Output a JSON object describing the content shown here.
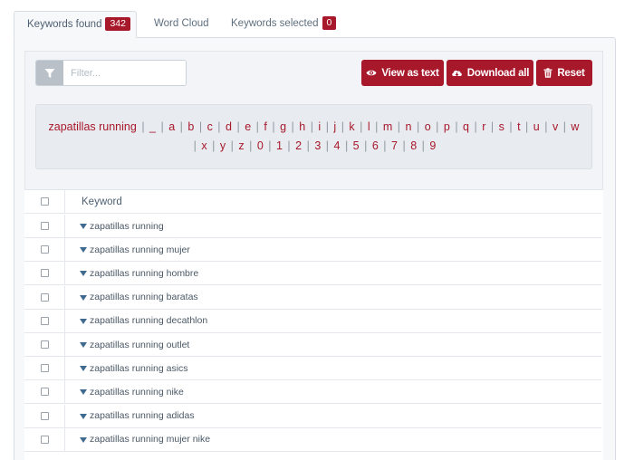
{
  "tabs": [
    {
      "label": "Keywords found",
      "badge": "342"
    },
    {
      "label": "Word Cloud"
    },
    {
      "label": "Keywords selected",
      "badge": "0"
    }
  ],
  "filter": {
    "placeholder": "Filter...",
    "value": "",
    "icon": "filter-icon"
  },
  "buttons": {
    "view_as_text": "View as text",
    "download_all": "Download all",
    "reset": "Reset"
  },
  "alphabet": {
    "query": "zapatillas running",
    "letters": [
      "_",
      "a",
      "b",
      "c",
      "d",
      "e",
      "f",
      "g",
      "h",
      "i",
      "j",
      "k",
      "l",
      "m",
      "n",
      "o",
      "p",
      "q",
      "r",
      "s",
      "t",
      "u",
      "v",
      "w",
      "x",
      "y",
      "z",
      "0",
      "1",
      "2",
      "3",
      "4",
      "5",
      "6",
      "7",
      "8",
      "9"
    ]
  },
  "table": {
    "header": "Keyword",
    "rows": [
      "zapatillas running",
      "zapatillas running mujer",
      "zapatillas running hombre",
      "zapatillas running baratas",
      "zapatillas running decathlon",
      "zapatillas running outlet",
      "zapatillas running asics",
      "zapatillas running nike",
      "zapatillas running adidas",
      "zapatillas running mujer nike"
    ]
  },
  "colors": {
    "accent": "#a8182b",
    "caret": "#3f6a8e"
  }
}
